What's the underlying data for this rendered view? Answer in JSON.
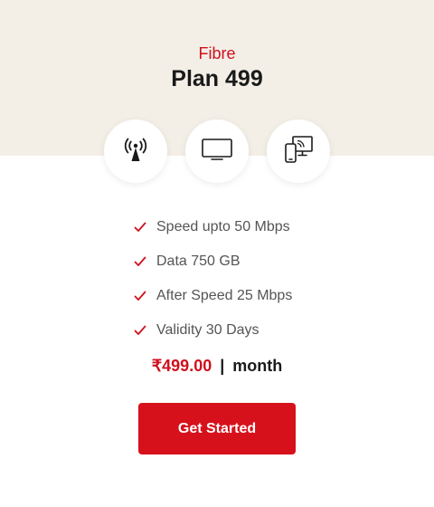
{
  "plan": {
    "type": "Fibre",
    "name": "Plan 499"
  },
  "icons": [
    "wifi-antenna-icon",
    "tv-icon",
    "devices-icon"
  ],
  "features": [
    "Speed upto 50 Mbps",
    "Data 750 GB",
    "After Speed 25 Mbps",
    "Validity 30 Days"
  ],
  "price": {
    "amount": "₹499.00",
    "separator": "|",
    "period": "month"
  },
  "cta": {
    "label": "Get Started"
  },
  "colors": {
    "accent": "#d0101d",
    "header_bg": "#f3efe7",
    "text_dark": "#1a1a1a",
    "text_muted": "#555555"
  }
}
